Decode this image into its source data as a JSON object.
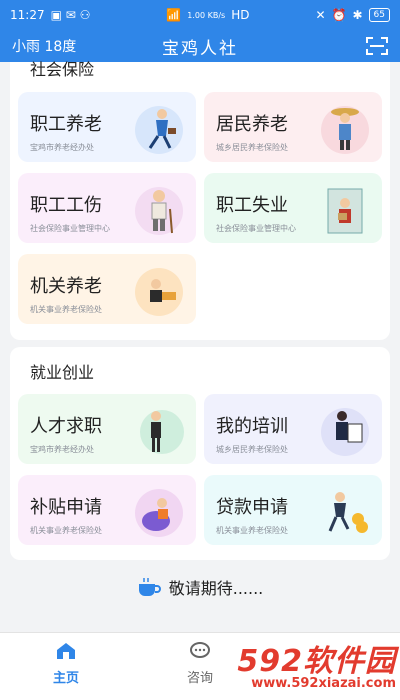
{
  "status_bar": {
    "time": "11:27",
    "net_speed": "1.00 KB/s",
    "network": "HD",
    "battery": "65"
  },
  "header": {
    "weather": "小雨 18度",
    "title": "宝鸡人社",
    "scan_icon": "scan-icon"
  },
  "social_insurance": {
    "title": "社会保险",
    "cards": [
      {
        "title": "职工养老",
        "subtitle": "宝鸡市养老经办处"
      },
      {
        "title": "居民养老",
        "subtitle": "城乡居民养老保险处"
      },
      {
        "title": "职工工伤",
        "subtitle": "社会保险事业管理中心"
      },
      {
        "title": "职工失业",
        "subtitle": "社会保险事业管理中心"
      },
      {
        "title": "机关养老",
        "subtitle": "机关事业养老保险处"
      }
    ]
  },
  "employment": {
    "title": "就业创业",
    "cards": [
      {
        "title": "人才求职",
        "subtitle": "宝鸡市养老经办处"
      },
      {
        "title": "我的培训",
        "subtitle": "城乡居民养老保险处"
      },
      {
        "title": "补贴申请",
        "subtitle": "机关事业养老保险处"
      },
      {
        "title": "贷款申请",
        "subtitle": "机关事业养老保险处"
      }
    ]
  },
  "coming_soon": "敬请期待......",
  "tabbar": {
    "tabs": [
      {
        "label": "主页"
      },
      {
        "label": "咨询"
      }
    ]
  },
  "watermark": {
    "brand": "592软件园",
    "url": "www.592xiazai.com"
  },
  "colors": {
    "primary": "#2f86e8",
    "watermark": "#e23b2e"
  }
}
